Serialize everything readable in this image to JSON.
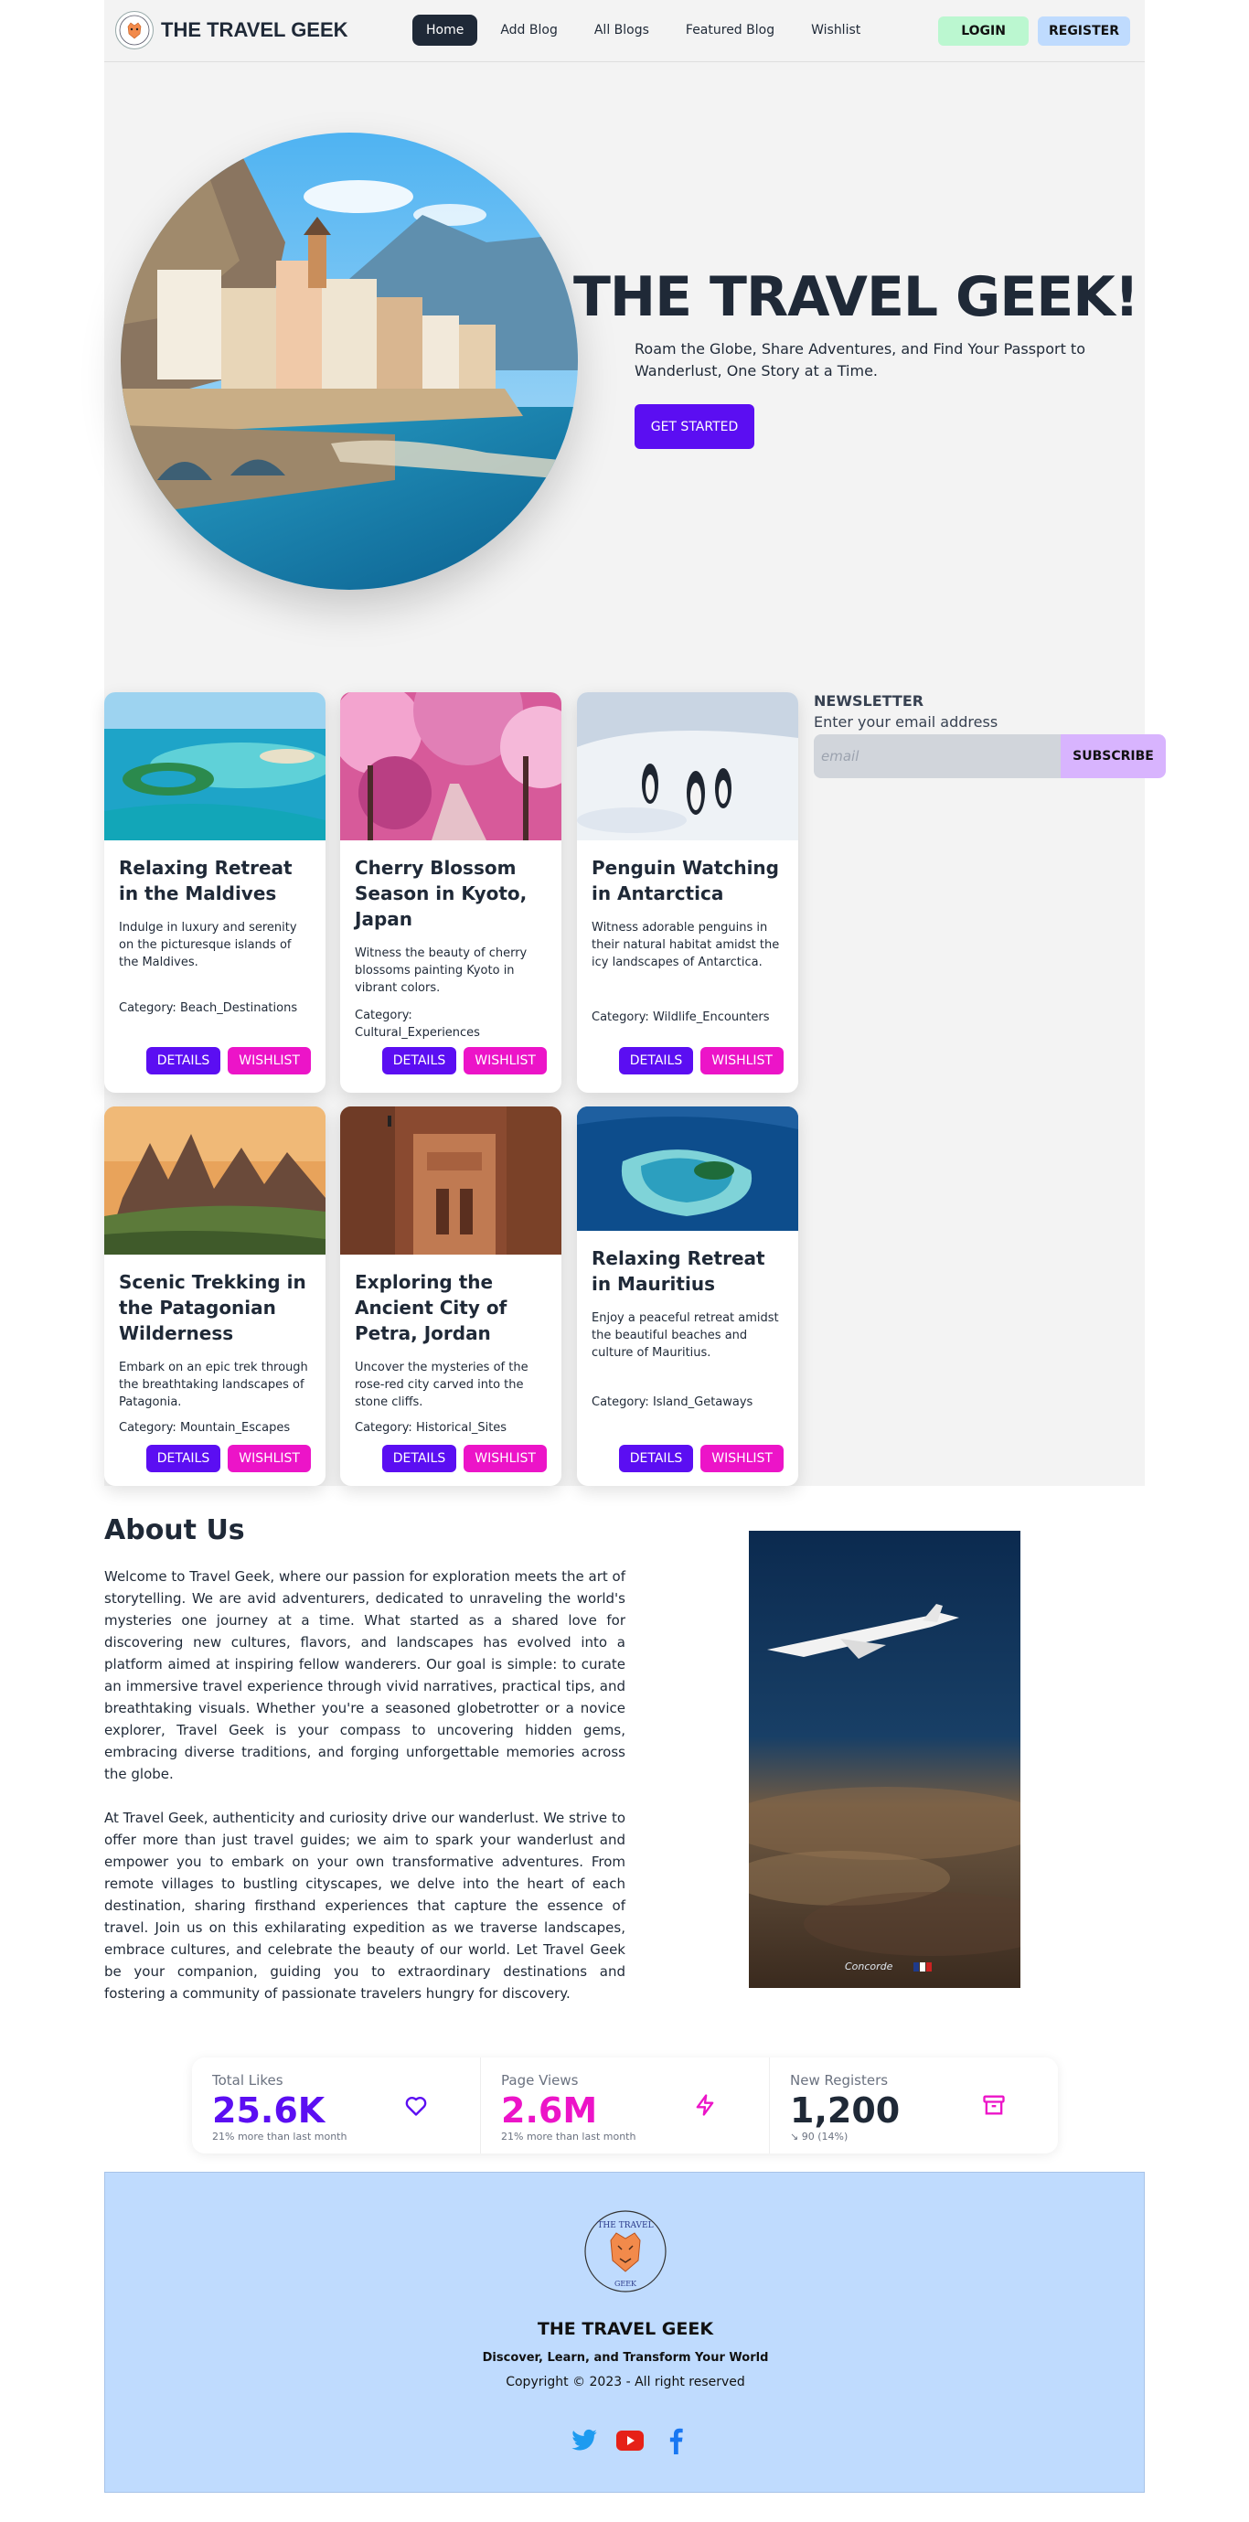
{
  "nav": {
    "brand": "THE TRAVEL GEEK",
    "links": [
      {
        "label": "Home",
        "active": true
      },
      {
        "label": "Add Blog",
        "active": false
      },
      {
        "label": "All Blogs",
        "active": false
      },
      {
        "label": "Featured Blog",
        "active": false
      },
      {
        "label": "Wishlist",
        "active": false
      }
    ],
    "login": "LOGIN",
    "register": "REGISTER"
  },
  "hero": {
    "title": "THE TRAVEL GEEK!",
    "subtitle": "Roam the Globe, Share Adventures, and Find Your Passport to Wanderlust, One Story at a Time.",
    "cta": "GET STARTED"
  },
  "cards": [
    {
      "title": "Relaxing Retreat in the Maldives",
      "desc": "Indulge in luxury and serenity on the picturesque islands of the Maldives.",
      "category": "Category: Beach_Destinations",
      "details": "DETAILS",
      "wishlist": "WISHLIST"
    },
    {
      "title": "Cherry Blossom Season in Kyoto, Japan",
      "desc": "Witness the beauty of cherry blossoms painting Kyoto in vibrant colors.",
      "category": "Category: Cultural_Experiences",
      "details": "DETAILS",
      "wishlist": "WISHLIST"
    },
    {
      "title": "Penguin Watching in Antarctica",
      "desc": "Witness adorable penguins in their natural habitat amidst the icy landscapes of Antarctica.",
      "category": "Category: Wildlife_Encounters",
      "details": "DETAILS",
      "wishlist": "WISHLIST"
    },
    {
      "title": "Scenic Trekking in the Patagonian Wilderness",
      "desc": "Embark on an epic trek through the breathtaking landscapes of Patagonia.",
      "category": "Category: Mountain_Escapes",
      "details": "DETAILS",
      "wishlist": "WISHLIST"
    },
    {
      "title": "Exploring the Ancient City of Petra, Jordan",
      "desc": "Uncover the mysteries of the rose-red city carved into the stone cliffs.",
      "category": "Category: Historical_Sites",
      "details": "DETAILS",
      "wishlist": "WISHLIST"
    },
    {
      "title": "Relaxing Retreat in Mauritius",
      "desc": "Enjoy a peaceful retreat amidst the beautiful beaches and culture of Mauritius.",
      "category": "Category: Island_Getaways",
      "details": "DETAILS",
      "wishlist": "WISHLIST"
    }
  ],
  "newsletter": {
    "title": "NEWSLETTER",
    "label": "Enter your email address",
    "placeholder": "email",
    "button": "SUBSCRIBE"
  },
  "about": {
    "title": "About Us",
    "p1": "Welcome to Travel Geek, where our passion for exploration meets the art of storytelling. We are avid adventurers, dedicated to unraveling the world's mysteries one journey at a time. What started as a shared love for discovering new cultures, flavors, and landscapes has evolved into a platform aimed at inspiring fellow wanderers. Our goal is simple: to curate an immersive travel experience through vivid narratives, practical tips, and breathtaking visuals. Whether you're a seasoned globetrotter or a novice explorer, Travel Geek is your compass to uncovering hidden gems, embracing diverse traditions, and forging unforgettable memories across the globe.",
    "p2": "At Travel Geek, authenticity and curiosity drive our wanderlust. We strive to offer more than just travel guides; we aim to spark your wanderlust and empower you to embark on your own transformative adventures. From remote villages to bustling cityscapes, we delve into the heart of each destination, sharing firsthand experiences that capture the essence of travel. Join us on this exhilarating expedition as we traverse landscapes, embrace cultures, and celebrate the beauty of our world. Let Travel Geek be your companion, guiding you to extraordinary destinations and fostering a community of passionate travelers hungry for discovery.",
    "image_caption": "Concorde"
  },
  "stats": [
    {
      "title": "Total Likes",
      "value": "25.6K",
      "desc": "21% more than last month",
      "color": "#5b0ef2",
      "icon": "heart-icon"
    },
    {
      "title": "Page Views",
      "value": "2.6M",
      "desc": "21% more than last month",
      "color": "#ec14c8",
      "icon": "bolt-icon"
    },
    {
      "title": "New Registers",
      "value": "1,200",
      "desc": "↘ 90 (14%)",
      "color": "#1f2937",
      "icon": "archive-icon"
    }
  ],
  "footer": {
    "logo_text_top": "THE TRAVEL",
    "logo_text_bottom": "GEEK",
    "brand": "THE TRAVEL GEEK",
    "tagline": "Discover, Learn, and Transform Your World",
    "copyright": "Copyright © 2023 - All right reserved"
  },
  "colors": {
    "primary": "#5b0ef2",
    "accent": "#ec14c8",
    "footer_bg": "#bfdbfe",
    "page_bg": "#f3f3f3"
  }
}
